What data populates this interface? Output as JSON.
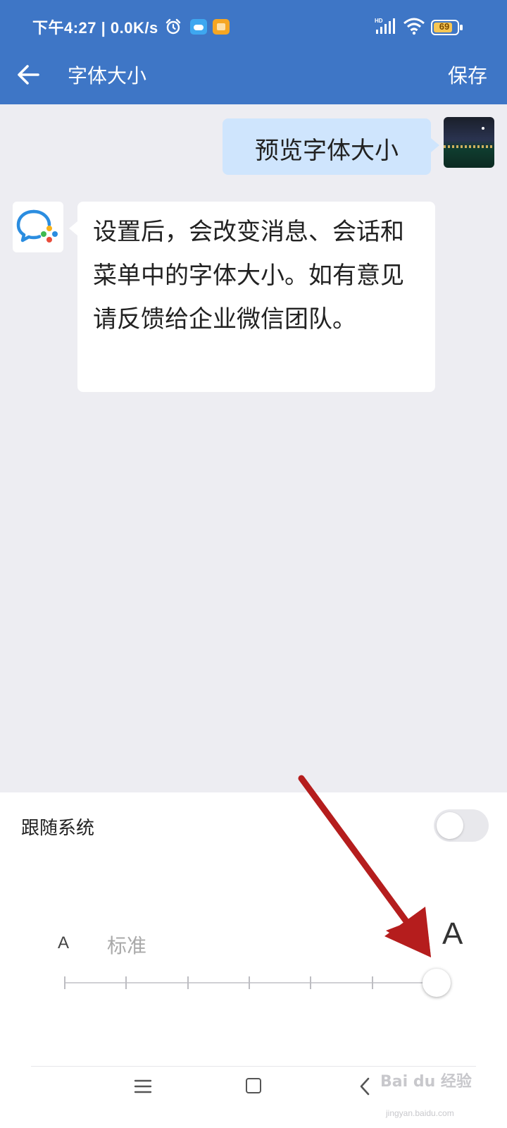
{
  "status_bar": {
    "time": "下午4:27 | 0.0K/s",
    "battery": "69",
    "icons": [
      "alarm-icon",
      "cloud-app-icon",
      "notes-app-icon",
      "hd-signal-icon",
      "wifi-icon",
      "battery-icon"
    ]
  },
  "header": {
    "title": "字体大小",
    "save_label": "保存",
    "back_icon": "arrow-left-icon"
  },
  "chat": {
    "outgoing_message": "预览字体大小",
    "incoming_message": "设置后，会改变消息、会话和菜单中的字体大小。如有意见 请反馈给企业微信团队。"
  },
  "settings": {
    "follow_system_label": "跟随系统",
    "follow_system_on": false,
    "small_a": "A",
    "standard_label": "标准",
    "large_a": "A",
    "slider_steps": 7,
    "slider_selected_step": 7
  },
  "watermark": {
    "text": "Bai du 经验",
    "sub": "jingyan.baidu.com"
  },
  "colors": {
    "header_bg": "#3e76c6",
    "outgoing_bubble": "#cfe5fd",
    "chat_bg": "#ededf2",
    "annotation_arrow": "#b51d1d"
  }
}
